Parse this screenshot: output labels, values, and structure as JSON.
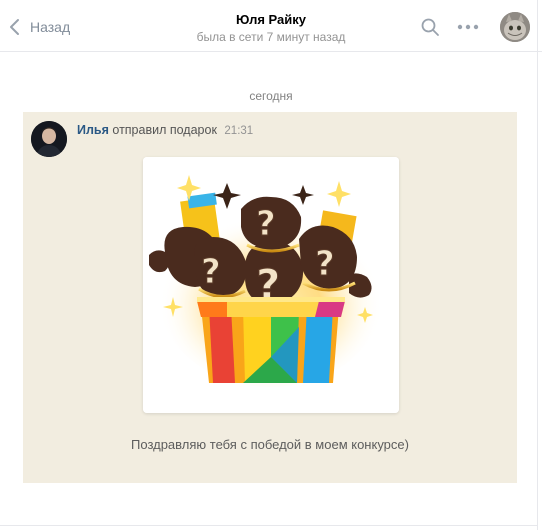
{
  "header": {
    "back_label": "Назад",
    "peer_name": "Юля Райку",
    "peer_status": "была в сети 7 минут назад"
  },
  "chat": {
    "date_separator": "сегодня",
    "message": {
      "author": "Илья",
      "action": "отправил подарок",
      "time": "21:31",
      "gift_text": "Поздравляю тебя с победой в моем конкурсе)",
      "gift_question_mark": "?"
    }
  },
  "colors": {
    "message_bg": "#f2ede0",
    "author_link": "#2a5885",
    "header_border": "#e7e8ec"
  },
  "icons": [
    "chevron-left-icon",
    "search-icon",
    "more-icon",
    "avatar",
    "gift-box-icon"
  ]
}
